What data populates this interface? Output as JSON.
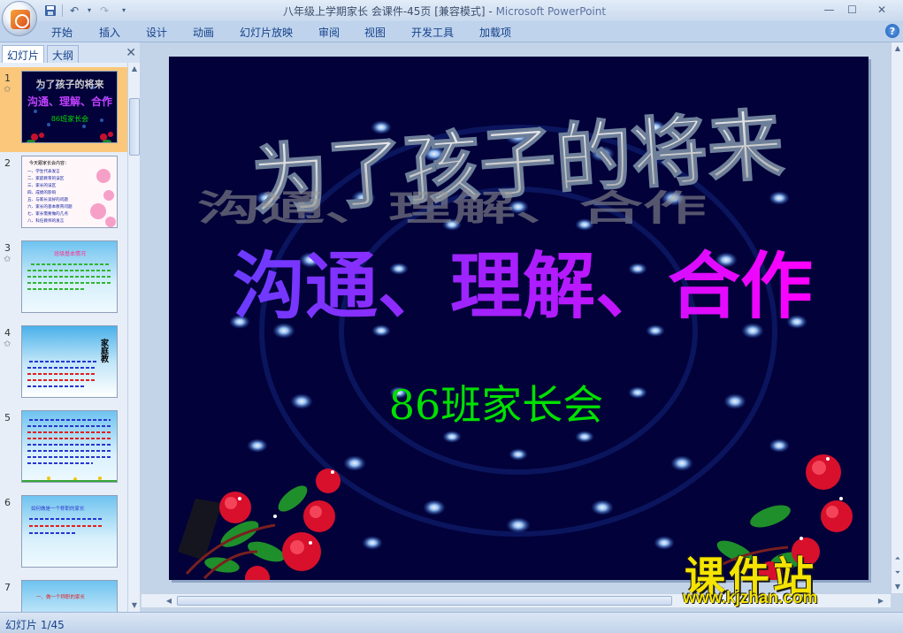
{
  "window": {
    "title": "八年级上学期家长 会课件-45页 [兼容模式] - Microsoft PowerPoint",
    "title_doc": "八年级上学期家长 会课件-45页 [兼容模式] - ",
    "title_app": "Microsoft PowerPoint"
  },
  "quick_access": [
    "save-icon",
    "undo-icon",
    "redo-icon",
    "customize-dropdown-icon"
  ],
  "ribbon_tabs": [
    "开始",
    "插入",
    "设计",
    "动画",
    "幻灯片放映",
    "审阅",
    "视图",
    "开发工具",
    "加载项"
  ],
  "panel": {
    "tabs": [
      "幻灯片",
      "大纲"
    ],
    "thumbnails": [
      {
        "number": "1",
        "has_animation": true,
        "selected": true
      },
      {
        "number": "2",
        "has_animation": false,
        "selected": false
      },
      {
        "number": "3",
        "has_animation": true,
        "selected": false
      },
      {
        "number": "4",
        "has_animation": true,
        "selected": false
      },
      {
        "number": "5",
        "has_animation": false,
        "selected": false
      },
      {
        "number": "6",
        "has_animation": false,
        "selected": false
      },
      {
        "number": "7",
        "has_animation": false,
        "selected": false
      }
    ]
  },
  "slide": {
    "title": "为了孩子的将来",
    "subtitle": "沟通、理解、合作",
    "footer": "86班家长会"
  },
  "thumb_text": {
    "t1_title": "为了孩子的将来",
    "t1_sub": "沟通、理解、合作",
    "t1_footer": "86班家长会",
    "t2_heading": "今天跟家长会内容：",
    "t2_items": [
      "一、学生代表发言",
      "二、家庭教育的误区",
      "三、家长的误区",
      "四、成绩的影响",
      "五、与家长谈好的问题",
      "六、家长的基本教育问题",
      "七、家长需要做的几点",
      "八、科任教师的发言"
    ],
    "t3_heading": "班级基本情况",
    "t4_side": "家庭教",
    "t6_text": "如何做是一个称职的家长",
    "t7_text": "一、做一个称职的家长"
  },
  "status": {
    "slide_indicator": "幻灯片 1/45"
  },
  "watermark": {
    "name": "课件站",
    "url": "www.kjzhan.com"
  },
  "colors": {
    "slide_background": "#020139",
    "title_fill": "#d0d0d0",
    "subtitle_start": "#6a3cff",
    "subtitle_end": "#ff00ff",
    "footer": "#00e000",
    "watermark": "#f5e400",
    "selected_thumb": "#fbc77a"
  }
}
